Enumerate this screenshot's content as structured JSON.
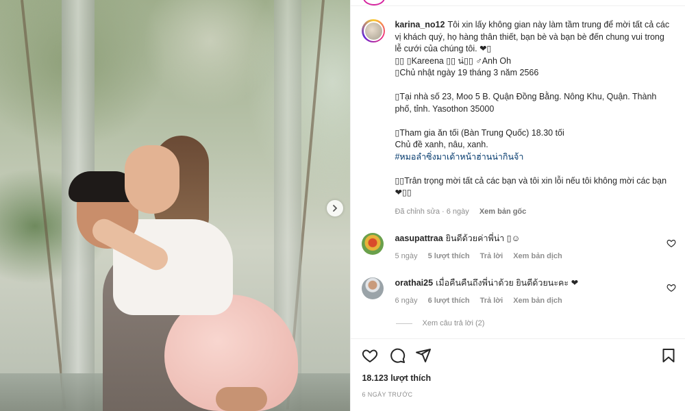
{
  "post": {
    "username": "karina_no12",
    "caption_lines": [
      "Tôi xin lấy không gian này làm tầm trung để mời tất cả các vị khách quý, họ hàng thân thiết, bạn bè và bạn bè đến chung vui trong lễ cưới của chúng tôi. ❤︎▯",
      "▯▯ ▯Kareena ▯▯ น่▯▯ ♂Anh Oh",
      "▯Chủ nhật ngày 19 tháng 3 năm 2566",
      "",
      "▯Tại nhà số 23, Moo 5 B. Quận Đồng Bằng. Nông Khu, Quận. Thành phố, tỉnh. Yasothon 35000",
      "",
      "▯Tham gia ăn tối (Bàn Trung Quốc) 18.30 tối",
      "Chủ đề xanh, nâu, xanh."
    ],
    "hashtag": "#หมอลำซิ่งมาเด้าหน้าฮ่านน่ากินจ้า",
    "closing_lines": [
      "",
      "▯▯Trân trọng mời tất cả các bạn và tôi xin lỗi nếu tôi không mời các bạn❤︎▯▯"
    ],
    "edited_label": "Đã chỉnh sửa · 6 ngày",
    "see_original": "Xem bản gốc"
  },
  "comments": [
    {
      "username": "aasupattraa",
      "text": "ยินดีด้วยค่าพี่น่า ▯☺",
      "age": "5 ngày",
      "likes": "5 lượt thích",
      "reply": "Trả lời",
      "translate": "Xem bản dịch",
      "avatar_color": "#e7b33a"
    },
    {
      "username": "orathai25",
      "text": "เมื่อคืนคืนถึงพี่น่าด้วย ยินดีด้วยนะคะ ❤",
      "age": "6 ngày",
      "likes": "6 lượt thích",
      "reply": "Trả lời",
      "translate": "Xem bản dịch",
      "avatar_color": "#9aa3a8"
    }
  ],
  "view_replies": "Xem câu trả lời (2)",
  "like_count": "18.123 lượt thích",
  "post_date": "6 NGÀY TRƯỚC",
  "icons": {
    "like": "heart-icon",
    "comment": "comment-icon",
    "share": "paper-plane-icon",
    "save": "bookmark-icon",
    "next": "chevron-right-icon"
  }
}
